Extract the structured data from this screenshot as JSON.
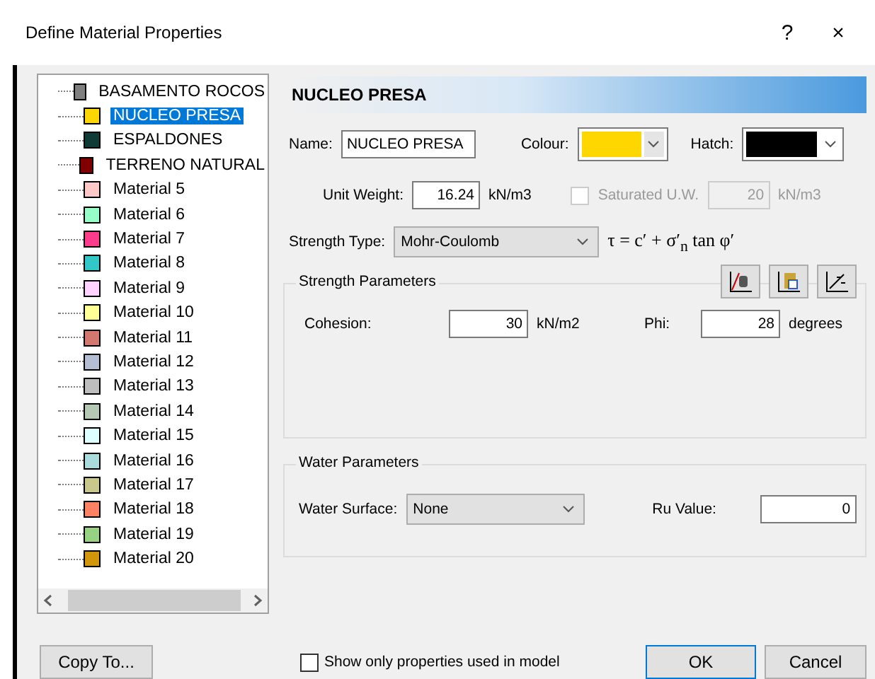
{
  "window": {
    "title": "Define Material Properties",
    "help": "?",
    "close": "×"
  },
  "materials": [
    {
      "name": "BASAMENTO ROCOS",
      "color": "#7f7f7f",
      "selected": false
    },
    {
      "name": "NUCLEO PRESA",
      "color": "#ffd700",
      "selected": true
    },
    {
      "name": "ESPALDONES",
      "color": "#0f3b36",
      "selected": false
    },
    {
      "name": "TERRENO NATURAL",
      "color": "#800000",
      "selected": false
    },
    {
      "name": "Material 5",
      "color": "#ffc8c8",
      "selected": false
    },
    {
      "name": "Material 6",
      "color": "#96ffc8",
      "selected": false
    },
    {
      "name": "Material 7",
      "color": "#ff3c8c",
      "selected": false
    },
    {
      "name": "Material 8",
      "color": "#32c8c8",
      "selected": false
    },
    {
      "name": "Material 9",
      "color": "#ffd2ff",
      "selected": false
    },
    {
      "name": "Material 10",
      "color": "#ffff96",
      "selected": false
    },
    {
      "name": "Material 11",
      "color": "#d2786e",
      "selected": false
    },
    {
      "name": "Material 12",
      "color": "#b4bed2",
      "selected": false
    },
    {
      "name": "Material 13",
      "color": "#bebebe",
      "selected": false
    },
    {
      "name": "Material 14",
      "color": "#b4c8b4",
      "selected": false
    },
    {
      "name": "Material 15",
      "color": "#dcffff",
      "selected": false
    },
    {
      "name": "Material 16",
      "color": "#aadcdc",
      "selected": false
    },
    {
      "name": "Material 17",
      "color": "#c8c88c",
      "selected": false
    },
    {
      "name": "Material 18",
      "color": "#ff8264",
      "selected": false
    },
    {
      "name": "Material 19",
      "color": "#96d282",
      "selected": false
    },
    {
      "name": "Material 20",
      "color": "#d2960a",
      "selected": false
    }
  ],
  "header": "NUCLEO PRESA",
  "name_label": "Name:",
  "name_value": "NUCLEO PRESA",
  "colour_label": "Colour:",
  "colour_swatch": {
    "color": "#ffd700"
  },
  "hatch_label": "Hatch:",
  "hatch_swatch": {
    "color": "#000000"
  },
  "unit_weight_label": "Unit Weight:",
  "unit_weight": "16.24",
  "unit_weight_unit": "kN/m3",
  "saturated": {
    "label": "Saturated U.W.",
    "checked": false,
    "disabled": true,
    "value": "20",
    "unit": "kN/m3"
  },
  "strength_type_label": "Strength Type:",
  "strength_type": "Mohr-Coulomb",
  "formula": "τ = c′ + σ′$_{n}$ tan φ′",
  "strength_group": "Strength Parameters",
  "cohesion_label": "Cohesion:",
  "cohesion": "30",
  "cohesion_unit": "kN/m2",
  "phi_label": "Phi:",
  "phi": "28",
  "phi_unit": "degrees",
  "water_group": "Water Parameters",
  "water_surface_label": "Water Surface:",
  "water_surface": "None",
  "ru_label": "Ru Value:",
  "ru": "0",
  "copy_button": "Copy To...",
  "show_only": {
    "label": "Show only properties used in model",
    "checked": false
  },
  "ok": "OK",
  "cancel": "Cancel"
}
